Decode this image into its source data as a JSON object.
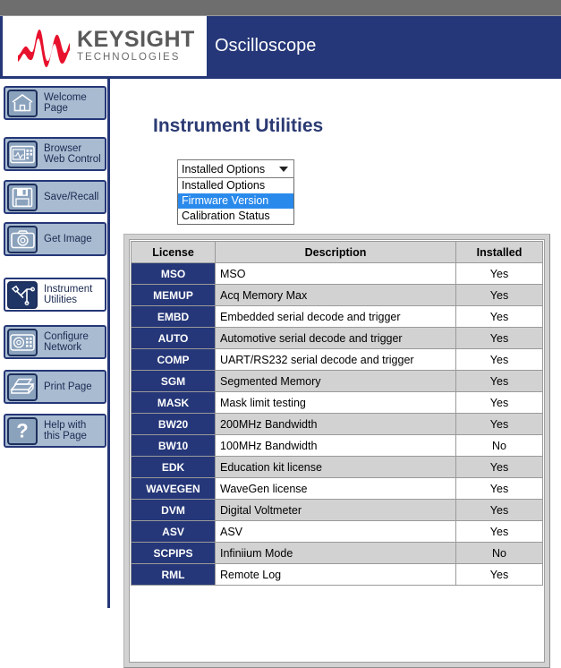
{
  "banner": {
    "logo_name": "KEYSIGHT",
    "logo_sub": "TECHNOLOGIES",
    "title": "Oscilloscope"
  },
  "sidebar": {
    "items": [
      {
        "label": "Welcome\nPage",
        "icon": "home-icon",
        "active": false
      },
      {
        "label": "Browser\nWeb Control",
        "icon": "monitor-icon",
        "active": false
      },
      {
        "label": "Save/Recall",
        "icon": "floppy-disk-icon",
        "active": false
      },
      {
        "label": "Get Image",
        "icon": "camera-icon",
        "active": false
      },
      {
        "label": "Instrument\nUtilities",
        "icon": "wrench-icon",
        "active": true
      },
      {
        "label": "Configure\nNetwork",
        "icon": "network-icon",
        "active": false
      },
      {
        "label": "Print Page",
        "icon": "printer-icon",
        "active": false
      },
      {
        "label": "Help with\nthis Page",
        "icon": "question-icon",
        "active": false
      }
    ]
  },
  "main": {
    "page_title": "Instrument Utilities",
    "section_title": "Installed Options",
    "utility_select": {
      "value": "Installed Options",
      "expanded": true,
      "options": [
        "Installed Options",
        "Firmware Version",
        "Calibration Status"
      ],
      "highlighted": "Firmware Version"
    },
    "table": {
      "columns": [
        "License",
        "Description",
        "Installed"
      ],
      "rows": [
        {
          "license": "MSO",
          "description": "MSO",
          "installed": "Yes"
        },
        {
          "license": "MEMUP",
          "description": "Acq Memory Max",
          "installed": "Yes"
        },
        {
          "license": "EMBD",
          "description": "Embedded serial decode and trigger",
          "installed": "Yes"
        },
        {
          "license": "AUTO",
          "description": "Automotive serial decode and trigger",
          "installed": "Yes"
        },
        {
          "license": "COMP",
          "description": "UART/RS232 serial decode and trigger",
          "installed": "Yes"
        },
        {
          "license": "SGM",
          "description": "Segmented Memory",
          "installed": "Yes"
        },
        {
          "license": "MASK",
          "description": "Mask limit testing",
          "installed": "Yes"
        },
        {
          "license": "BW20",
          "description": "200MHz Bandwidth",
          "installed": "Yes"
        },
        {
          "license": "BW10",
          "description": "100MHz Bandwidth",
          "installed": "No"
        },
        {
          "license": "EDK",
          "description": "Education kit license",
          "installed": "Yes"
        },
        {
          "license": "WAVEGEN",
          "description": "WaveGen license",
          "installed": "Yes"
        },
        {
          "license": "DVM",
          "description": "Digital Voltmeter",
          "installed": "Yes"
        },
        {
          "license": "ASV",
          "description": "ASV",
          "installed": "Yes"
        },
        {
          "license": "SCPIPS",
          "description": "Infiniium Mode",
          "installed": "No"
        },
        {
          "license": "RML",
          "description": "Remote Log",
          "installed": "Yes"
        }
      ]
    }
  },
  "colors": {
    "brand_navy": "#253778",
    "brand_red": "#e8112d",
    "section_green": "#11a256",
    "select_highlight": "#2a8aec",
    "row_alt": "#d2d2d2"
  }
}
